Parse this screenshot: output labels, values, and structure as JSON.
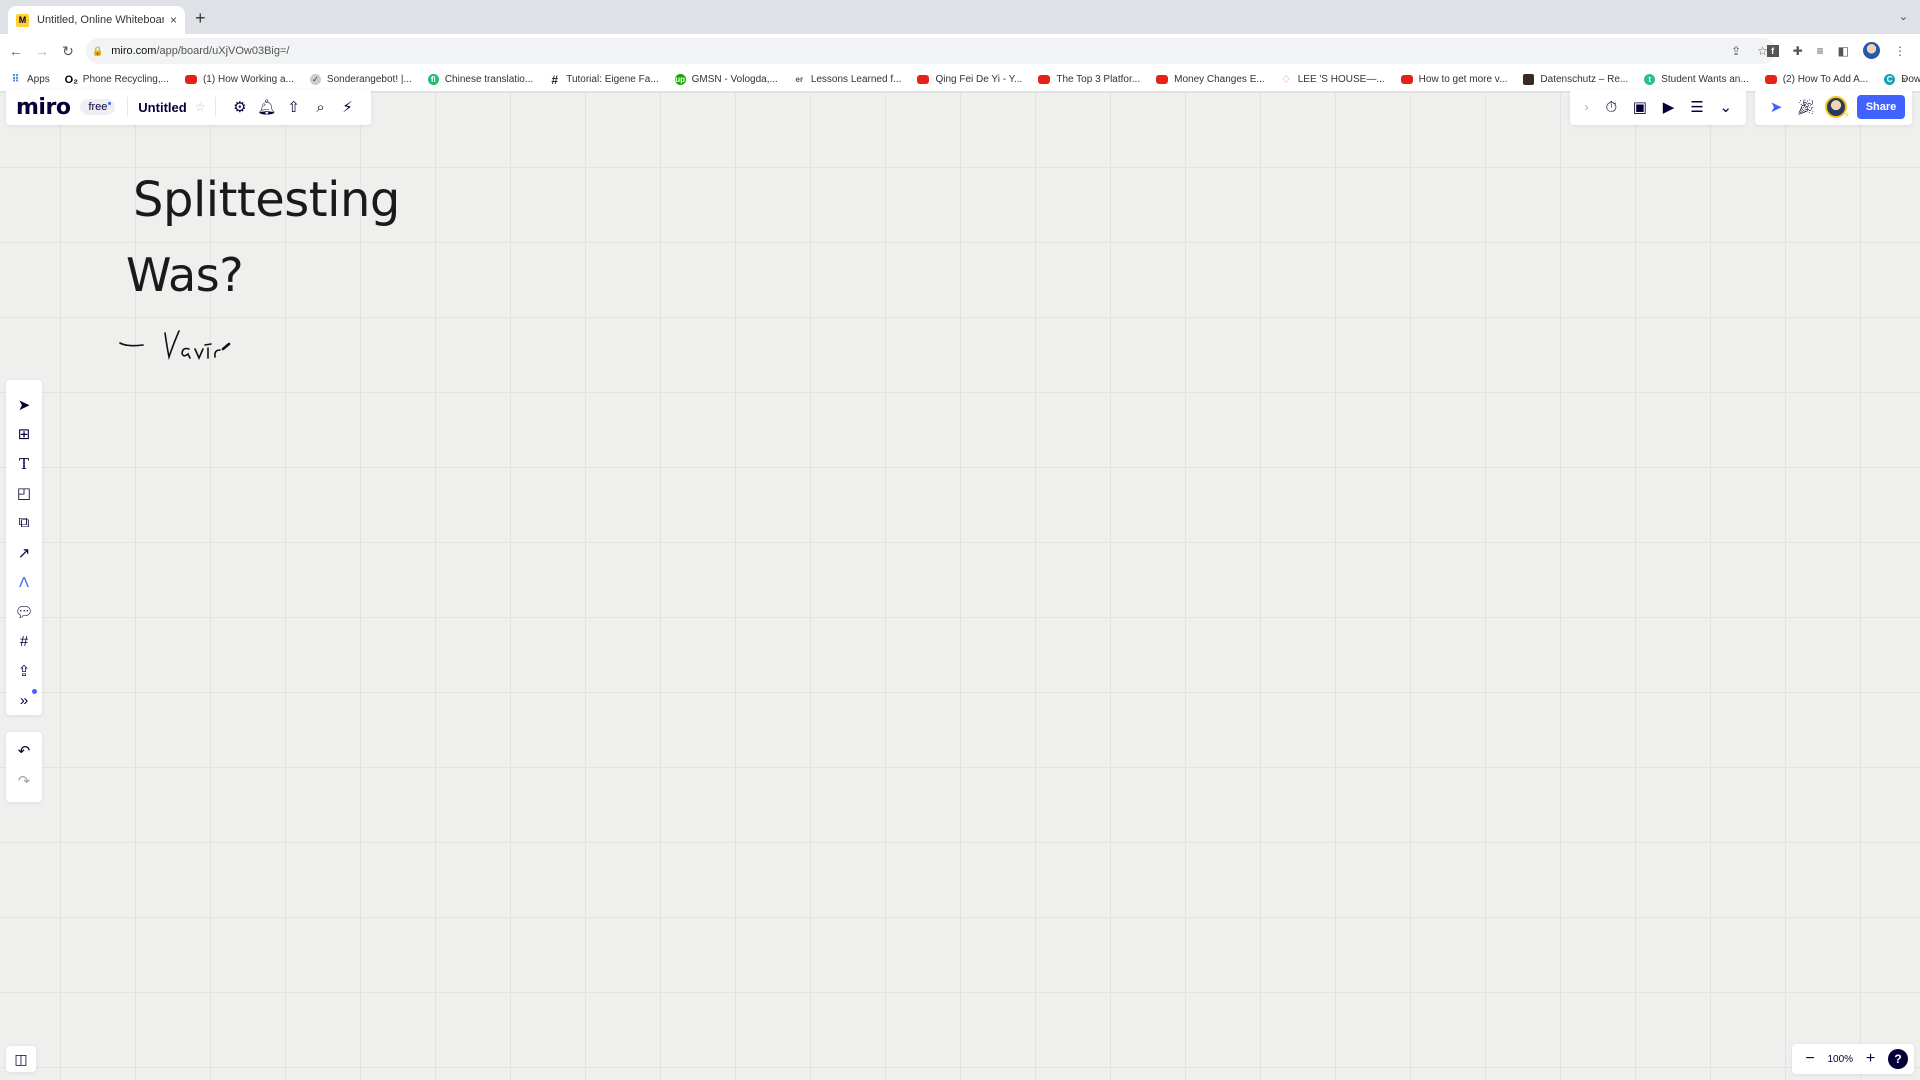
{
  "browser": {
    "tab": {
      "favicon": "miro-icon",
      "title": "Untitled, Online Whiteboard for",
      "close": "×"
    },
    "new_tab": "+",
    "tabs_menu": "⌄",
    "nav": {
      "back": "←",
      "forward": "→",
      "reload": "↻"
    },
    "url": {
      "host": "miro.com",
      "path": "/app/board/uXjVOw03Big=/"
    },
    "omnibox_icons": [
      "share-icon",
      "bookmark-star-icon"
    ],
    "extensions": [
      "facebook-icon",
      "extensions-puzzle-icon",
      "media-queue-icon",
      "side-panel-icon",
      "profile-avatar",
      "more-menu-icon"
    ],
    "bookmarks": [
      {
        "label": "Apps",
        "icon": "apps-grid-icon"
      },
      {
        "label": "Phone Recycling,...",
        "icon": "o2-icon"
      },
      {
        "label": "(1) How Working a...",
        "icon": "youtube-icon"
      },
      {
        "label": "Sonderangebot! |...",
        "icon": "checkmark-circle-icon"
      },
      {
        "label": "Chinese translatio...",
        "icon": "fiverr-icon"
      },
      {
        "label": "Tutorial: Eigene Fa...",
        "icon": "hash-icon"
      },
      {
        "label": "GMSN - Vologda,...",
        "icon": "upwork-icon"
      },
      {
        "label": "Lessons Learned f...",
        "icon": "er-icon"
      },
      {
        "label": "Qing Fei De Yi - Y...",
        "icon": "youtube-icon"
      },
      {
        "label": "The Top 3 Platfor...",
        "icon": "youtube-icon"
      },
      {
        "label": "Money Changes E...",
        "icon": "youtube-icon"
      },
      {
        "label": "LEE 'S HOUSE—...",
        "icon": "airbnb-icon"
      },
      {
        "label": "How to get more v...",
        "icon": "youtube-icon"
      },
      {
        "label": "Datenschutz – Re...",
        "icon": "site-icon"
      },
      {
        "label": "Student Wants an...",
        "icon": "t-circle-icon"
      },
      {
        "label": "(2) How To Add A...",
        "icon": "youtube-icon"
      },
      {
        "label": "Download - Cooki...",
        "icon": "c-circle-icon"
      }
    ],
    "bookmarks_more": "»"
  },
  "miro": {
    "logo": "miro",
    "plan": "free",
    "board_title": "Untitled",
    "top_left_tools": [
      "settings-icon",
      "notifications-bell-icon",
      "export-upload-icon",
      "search-icon",
      "integrations-plug-icon"
    ],
    "top_right_tools": [
      "timer-icon",
      "card-icon",
      "presentation-icon",
      "notes-icon",
      "more-chevrons-icon"
    ],
    "collab_tools": [
      "cursor-share-icon",
      "reactions-party-icon"
    ],
    "share_label": "Share",
    "left_toolbar": [
      {
        "name": "select",
        "icon": "cursor-arrow-icon"
      },
      {
        "name": "templates",
        "icon": "template-layout-icon"
      },
      {
        "name": "text",
        "icon": "text-icon"
      },
      {
        "name": "sticky-note",
        "icon": "sticky-note-icon"
      },
      {
        "name": "shapes",
        "icon": "shapes-icon"
      },
      {
        "name": "connection-line",
        "icon": "arrow-line-icon"
      },
      {
        "name": "pen",
        "icon": "pen-icon",
        "active": true
      },
      {
        "name": "comment",
        "icon": "comment-icon"
      },
      {
        "name": "frame",
        "icon": "frame-icon"
      },
      {
        "name": "upload",
        "icon": "upload-icon"
      },
      {
        "name": "more-apps",
        "icon": "more-apps-icon",
        "badge": true
      }
    ],
    "undo": "undo-icon",
    "redo": "redo-icon",
    "zoom_level": "100%",
    "zoom_out": "−",
    "zoom_in": "+",
    "help": "?"
  },
  "board": {
    "heading1": "Splittesting",
    "heading2": "Was?",
    "handwriting": "– Varia"
  },
  "colors": {
    "accent": "#4262ff",
    "brand_dark": "#050038",
    "canvas_bg": "#efefee",
    "grid_line": "#e2e2e1"
  }
}
